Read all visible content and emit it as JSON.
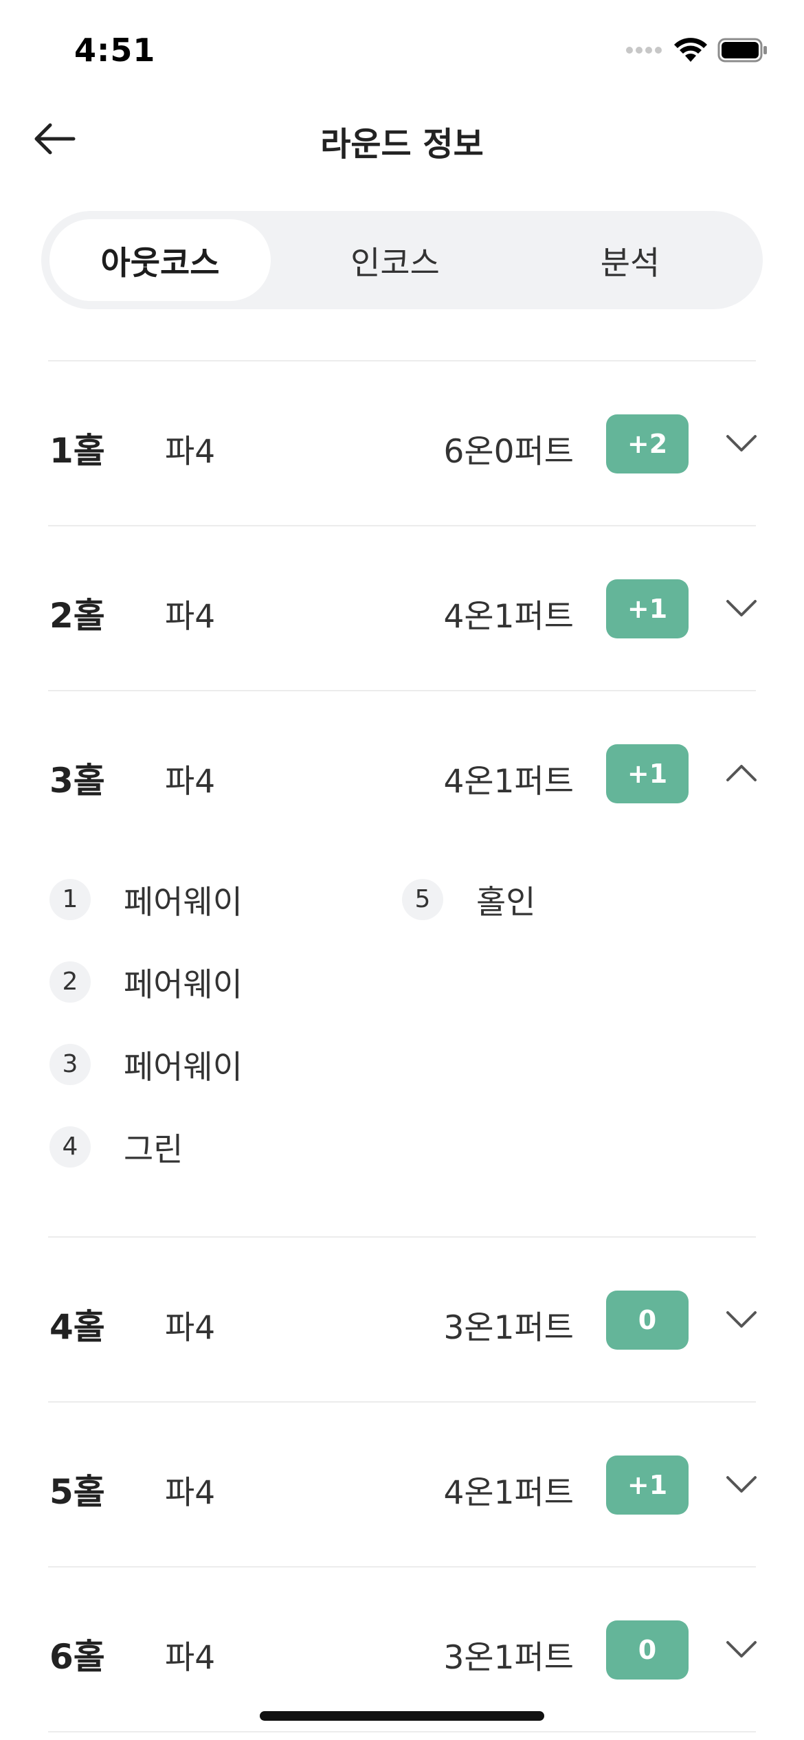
{
  "status_bar": {
    "time": "4:51",
    "icons": [
      "signal-icon",
      "wifi-icon",
      "battery-icon"
    ]
  },
  "header": {
    "back_icon": "arrow-left-icon",
    "title": "라운드 정보"
  },
  "tabs": [
    {
      "label": "아웃코스",
      "active": true
    },
    {
      "label": "인코스",
      "active": false
    },
    {
      "label": "분석",
      "active": false
    }
  ],
  "colors": {
    "badge": "#64b599",
    "tab_background": "#f1f2f4",
    "divider": "#ececec"
  },
  "holes": [
    {
      "name": "1홀",
      "par": "파4",
      "result": "6온0퍼트",
      "score": "+2",
      "expanded": false
    },
    {
      "name": "2홀",
      "par": "파4",
      "result": "4온1퍼트",
      "score": "+1",
      "expanded": false
    },
    {
      "name": "3홀",
      "par": "파4",
      "result": "4온1퍼트",
      "score": "+1",
      "expanded": true,
      "shots": [
        {
          "num": "1",
          "label": "페어웨이"
        },
        {
          "num": "2",
          "label": "페어웨이"
        },
        {
          "num": "3",
          "label": "페어웨이"
        },
        {
          "num": "4",
          "label": "그린"
        },
        {
          "num": "5",
          "label": "홀인"
        }
      ]
    },
    {
      "name": "4홀",
      "par": "파4",
      "result": "3온1퍼트",
      "score": "0",
      "expanded": false
    },
    {
      "name": "5홀",
      "par": "파4",
      "result": "4온1퍼트",
      "score": "+1",
      "expanded": false
    },
    {
      "name": "6홀",
      "par": "파4",
      "result": "3온1퍼트",
      "score": "0",
      "expanded": false
    }
  ]
}
